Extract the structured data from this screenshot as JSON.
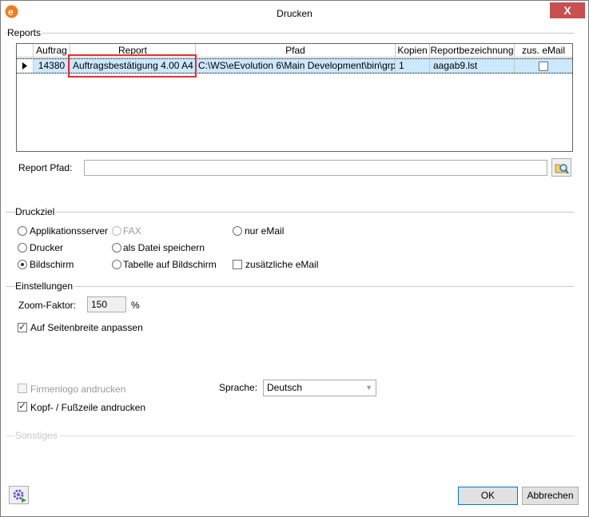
{
  "window": {
    "title": "Drucken",
    "close_glyph": "X",
    "app_icon": "e-icon"
  },
  "reports_group": {
    "title": "Reports",
    "columns": [
      "Auftrag",
      "Report",
      "Pfad",
      "Kopien",
      "Reportbezeichnung",
      "zus. eMail"
    ],
    "rows": [
      {
        "auftrag": "14380",
        "report": "Auftragsbestätigung 4.00 A4",
        "pfad": "C:\\WS\\eEvolution 6\\Main Development\\bin\\grp\\",
        "kopien": "1",
        "bezeichnung": "aagab9.lst",
        "email": false
      }
    ]
  },
  "report_pfad": {
    "label": "Report Pfad:",
    "value": "",
    "browse_icon": "folder-search-icon"
  },
  "druckziel": {
    "title": "Druckziel",
    "options": {
      "applikationsserver": "Applikationsserver",
      "fax": "FAX",
      "nur_email": "nur eMail",
      "drucker": "Drucker",
      "als_datei": "als Datei speichern",
      "bildschirm": "Bildschirm",
      "tabelle": "Tabelle auf Bildschirm"
    },
    "selected": "Bildschirm",
    "zusaetzliche_email": {
      "label": "zusätzliche eMail",
      "checked": false
    }
  },
  "einstellungen": {
    "title": "Einstellungen",
    "zoom_label": "Zoom-Faktor:",
    "zoom_value": "150",
    "zoom_unit": "%",
    "auf_seitenbreite": {
      "label": "Auf Seitenbreite anpassen",
      "checked": true
    },
    "firmenlogo": {
      "label": "Firmenlogo andrucken",
      "checked": false,
      "enabled": false
    },
    "kopf_fusszeile": {
      "label": "Kopf- / Fußzeile andrucken",
      "checked": true
    },
    "sprache_label": "Sprache:",
    "sprache_value": "Deutsch"
  },
  "sonstiges": {
    "title": "Sonstiges"
  },
  "footer": {
    "ok_label": "OK",
    "cancel_label": "Abbrechen",
    "settings_icon": "gear-icon"
  },
  "colors": {
    "selection": "#cce8ff",
    "highlight_box": "#e03030",
    "close": "#c75050",
    "accent": "#0078d7"
  }
}
